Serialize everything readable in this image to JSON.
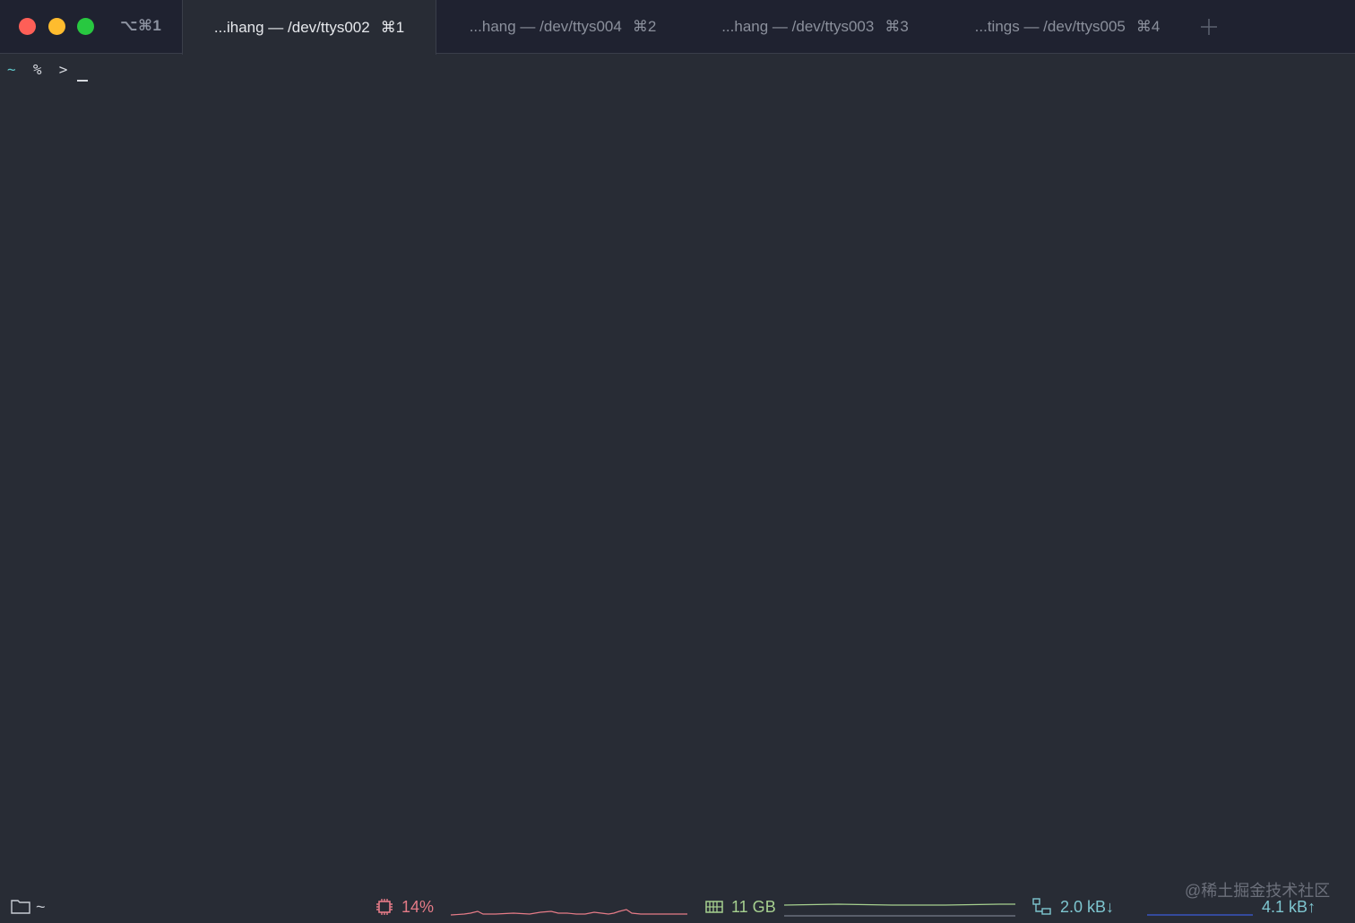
{
  "window": {
    "shortcut": "⌥⌘1"
  },
  "tabs": [
    {
      "label": "...ihang — /dev/ttys002",
      "shortcut": "⌘1",
      "active": true
    },
    {
      "label": "...hang — /dev/ttys004",
      "shortcut": "⌘2",
      "active": false
    },
    {
      "label": "...hang — /dev/ttys003",
      "shortcut": "⌘3",
      "active": false
    },
    {
      "label": "...tings — /dev/ttys005",
      "shortcut": "⌘4",
      "active": false
    }
  ],
  "new_tab_icon": "plus-icon",
  "terminal": {
    "cwd": "~",
    "prompt": "%  >"
  },
  "statusbar": {
    "folder_icon": "folder-icon",
    "folder": "~",
    "cpu": {
      "icon": "cpu-icon",
      "value": "14%",
      "color": "#e57b87"
    },
    "memory": {
      "icon": "memory-icon",
      "value": "11 GB",
      "color": "#a6d08f"
    },
    "network": {
      "icon": "network-icon",
      "down": "2.0 kB↓",
      "up": "4.1 kB↑",
      "color": "#7ec6d0"
    }
  },
  "watermark": "@稀土掘金技术社区",
  "colors": {
    "background": "#282c35",
    "titlebar": "#1f2230",
    "close": "#fe5f57",
    "minimize": "#febc2e",
    "maximize": "#28c840"
  }
}
